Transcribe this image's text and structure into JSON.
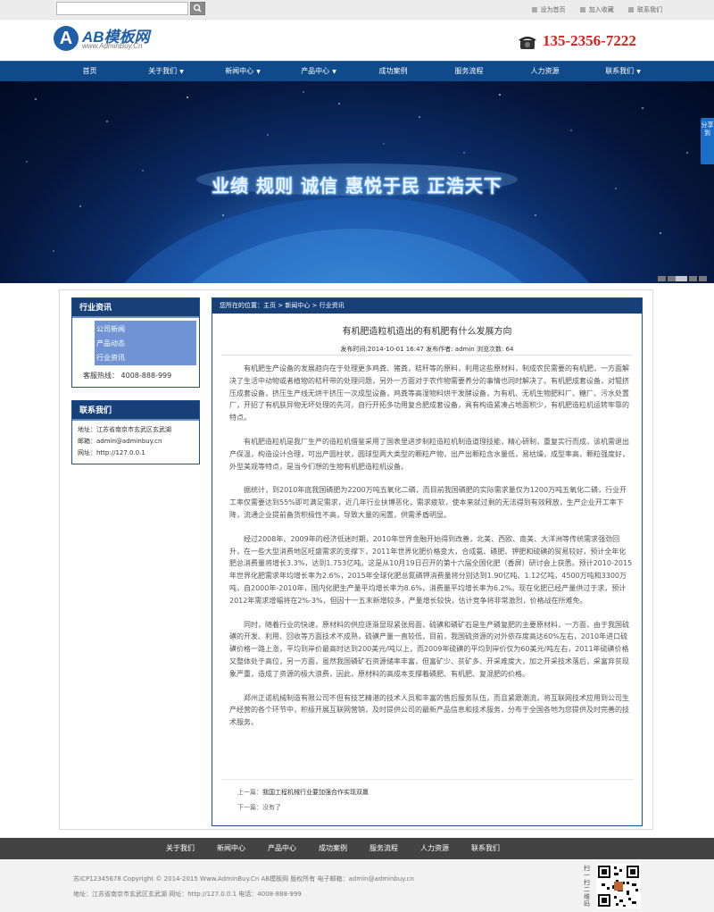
{
  "topbar": {
    "search_placeholder": "",
    "links": [
      "设为首页",
      "加入收藏",
      "联系我们"
    ]
  },
  "header": {
    "logo_mark": "A",
    "logo_title": "AB模板网",
    "logo_subtitle": "www.AdminBuy.Cn",
    "phone": "135-2356-7222"
  },
  "nav": {
    "items": [
      {
        "label": "首页",
        "caret": ""
      },
      {
        "label": "关于我们",
        "caret": "▼"
      },
      {
        "label": "新闻中心",
        "caret": "▼"
      },
      {
        "label": "产品中心",
        "caret": "▼"
      },
      {
        "label": "成功案例",
        "caret": ""
      },
      {
        "label": "服务流程",
        "caret": ""
      },
      {
        "label": "人力资源",
        "caret": ""
      },
      {
        "label": "联系我们",
        "caret": "▼"
      }
    ]
  },
  "banner": {
    "slogan": "业绩 规则 诚信 惠悦于民 正浩天下",
    "share_label": "分享到",
    "slide_count": 5,
    "active_slide": 3
  },
  "sidebar": {
    "title": "行业资讯",
    "items": [
      "公司新闻",
      "产品动态",
      "行业资讯"
    ],
    "hotline": "客服热线：  4008-888-999",
    "contact_title": "联系我们",
    "contact": [
      "地址：江苏省南京市玄武区玄武湖",
      "邮箱：admin@adminbuy.cn",
      "网址：http://127.0.0.1"
    ]
  },
  "article": {
    "breadcrumb": "您所在的位置：主页 > 新闻中心 > 行业资讯",
    "title": "有机肥造粒机造出的有机肥有什么发展方向",
    "meta": "发布时间:2014-10-01 16:47 发布作者: admin 浏览次数: 64",
    "paragraphs": [
      "有机肥生产设备的发展趋向在于处理更多鸡粪、猪粪，秸秆等的原料，利用这些原材料，制成农民需要的有机肥，一方面解决了生活中动物或者植物的秸秆带的处理问题，另外一方面对于农作物需要养分的事情也同时解决了。有机肥成套设备，对辊挤压成套设备，挤压生产线无烘干挤压一次成型设备，鸡粪等高湿物料烘干发酵设备，为有机、无机生物肥料厂、糖厂、污水处置厂，开招了有机肤异物无坏处理的先河，自行开拓多功用复合肥成套设备，具有构造紧凑占地面积少，有机肥造粒机运转牢靠的特点。",
      "有机肥造粒机是我厂生产的造粒机借鉴采用了国表里进步制粒造粒机制造道理技能，精心研制，重复实行而成，该机需退出产保温，构造设计合理，可出产圆柱状，圆球型两大类型的颗粒产物，出产出颗粒含水量低，易枯燥，成型率高，颗粒强度好，外型美观等特点，是当今们想的生物有机肥造粒机设备。",
      "据统计，到2010年底我国磷肥为2200万吨五氧化二磷，而目前我国磷肥的实际需求量仅为1200万吨五氧化二磷，行业开工率仅需要达到55%即可满足需求，近几年行业扶博恶化，需求疲软，使本来就过剩的无法得到有效释放，生产企业开工率下降，流通企业提前备货积极性不高，导致大量的闲置，供需矛盾明显。",
      "经过2008年、2009年的经济低迷时期，2010年世界金融开始得到改善，北美、西欧、南美、大洋洲等传统需求强劲回升，在一些大型消费地区旺盛需求的支撑下，2011年世界化肥价格变大，合成氨、磷肥、钾肥和硫磺的贸易较好，预计全年化肥总消费量将增长3.3%，达到1.753亿吨。这是从10月19日召开的第十六届全国化肥（香屏）研讨会上获悉。预计2010-2015年世界化肥需求年均增长率为2.6%，2015年全球化肥总氮磷钾消费量将分别达到1.90亿吨、1.12亿吨，4500万吨和3300万吨，自2000年-2010年，国内化肥生产量平均增长率为8.6%，消费量平均增长率为6.2%。现在化肥已经产量供过于求，预计2012年需求增幅将在2%-3%，但因十一五末新增较多，产量增长较快，估计竞争将非常激烈，价格战在所难免。",
      "同时，随着行业的快速，原材料的供应逐渐显现紧张局面，硫磺和磷矿石是生产磷复肥的主要原材料，一方面，由于我国硫磺的开发、利用、回收等方面技术不成熟，硫磺产量一直较低，目前，我国硫资源的对外依存度高达60%左右，2010年进口硫磺价格一路上涨，平均到岸价最高时达到200美元/吨以上，而2009年硫磺的平均到岸价仅为60美元/吨左右，2011年硫磺价格又整体处于高位，另一方面，虽然我国磷矿石资源储率丰富，但富矿少、贫矿多、开采难度大，加之开采技术落后，采富弃贫现象严重，造成了资源的极大浪费，因此，原材料的高成本支撑着磷肥、有机肥、复混肥的价格。",
      "郑州正诺机械制造有限公司不但有技艺精湛的技术人员和丰富的售后服务队伍，而且紧跟潮流，将互联网技术应用到公司生产经营的各个环节中，积极开展互联网营销，及时提供公司的最新产品信息和技术服务，分布于全国各地为您提供及时完善的技术服务。"
    ],
    "prev_label": "上一篇：",
    "prev": "我国工程机械行业要加强合作实现双赢",
    "next_label": "下一篇：",
    "next": "没有了"
  },
  "footer": {
    "nav": [
      "关于我们",
      "新闻中心",
      "产品中心",
      "成功案例",
      "服务流程",
      "人力资源",
      "联系我们"
    ],
    "line1": "苏ICP12345678  Copyright © 2014-2015 Www.AdminBuy.Cn AB模板网 版权所有  电子邮箱：admin@adminbuy.cn",
    "line2": "地址：江苏省南京市玄武区玄武湖    网址：http://127.0.0.1    电话：4008-888-999",
    "qr_label": "扫一扫二维码"
  },
  "colors": {
    "nav_blue": "#0f4a8b",
    "sidebar_blue": "#173f78",
    "phone_red": "#d9211c",
    "footer_dark": "#434343"
  }
}
